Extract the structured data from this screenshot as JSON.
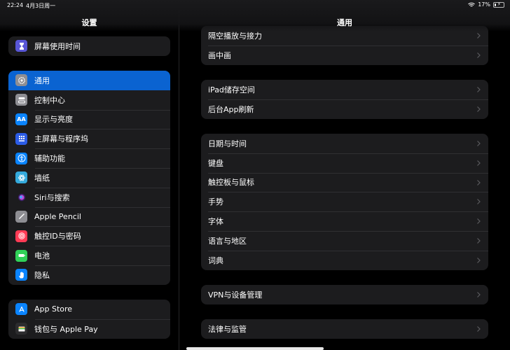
{
  "status_bar": {
    "time": "22:24",
    "date": "4月3日周一",
    "battery_text": "17%",
    "battery_level": 0.17
  },
  "sidebar": {
    "title": "设置",
    "groups": [
      {
        "items": [
          {
            "label": "屏幕使用时间",
            "icon": "hourglass-icon",
            "color": "#5856d6"
          }
        ]
      },
      {
        "items": [
          {
            "label": "通用",
            "icon": "gear-icon",
            "color": "#8e8e93",
            "selected": true
          },
          {
            "label": "控制中心",
            "icon": "toggles-icon",
            "color": "#8e8e93"
          },
          {
            "label": "显示与亮度",
            "icon": "text-size-icon",
            "color": "#0a84ff"
          },
          {
            "label": "主屏幕与程序坞",
            "icon": "grid-icon",
            "color": "#2c5ce6"
          },
          {
            "label": "辅助功能",
            "icon": "accessibility-icon",
            "color": "#0a84ff"
          },
          {
            "label": "墙纸",
            "icon": "flower-icon",
            "color": "#34aadc"
          },
          {
            "label": "Siri与搜索",
            "icon": "siri-icon",
            "color": "#1c1c1e"
          },
          {
            "label": "Apple Pencil",
            "icon": "pencil-icon",
            "color": "#8e8e93"
          },
          {
            "label": "触控ID与密码",
            "icon": "fingerprint-icon",
            "color": "#ff3b55"
          },
          {
            "label": "电池",
            "icon": "battery-icon",
            "color": "#30d158"
          },
          {
            "label": "隐私",
            "icon": "hand-icon",
            "color": "#0a84ff"
          }
        ]
      },
      {
        "items": [
          {
            "label": "App Store",
            "icon": "appstore-icon",
            "color": "#0a84ff"
          },
          {
            "label": "钱包与 Apple Pay",
            "icon": "wallet-icon",
            "color": "#2c2c2e"
          }
        ]
      }
    ]
  },
  "detail": {
    "title": "通用",
    "groups": [
      {
        "items": [
          "隔空播放与接力",
          "画中画"
        ]
      },
      {
        "items": [
          "iPad储存空间",
          "后台App刷新"
        ]
      },
      {
        "items": [
          "日期与时间",
          "键盘",
          "触控板与鼠标",
          "手势",
          "字体",
          "语言与地区",
          "词典"
        ]
      },
      {
        "items": [
          "VPN与设备管理"
        ]
      },
      {
        "items": [
          "法律与监管"
        ]
      }
    ]
  }
}
